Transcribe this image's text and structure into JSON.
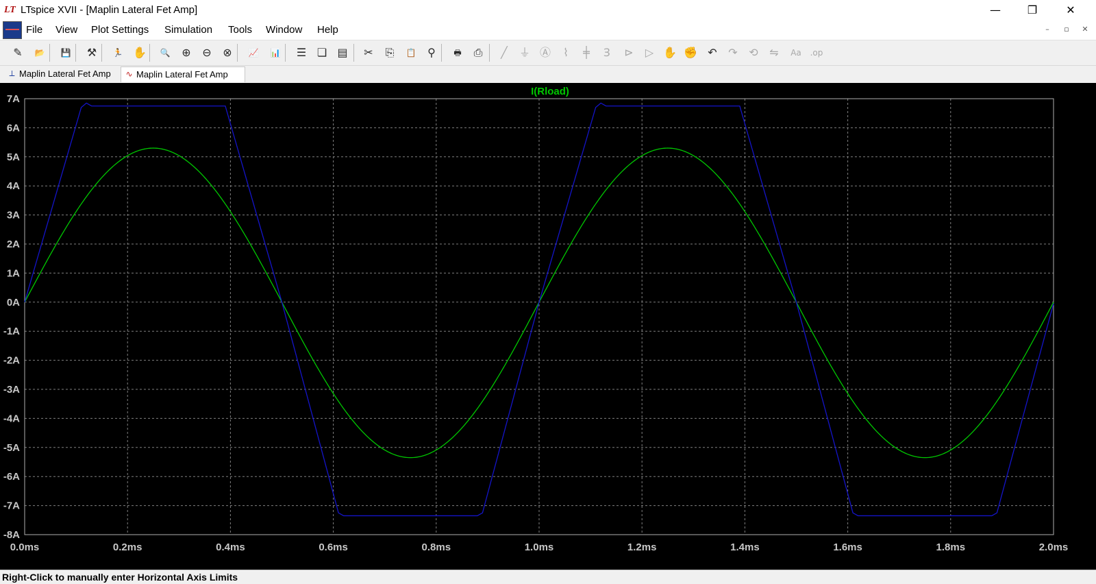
{
  "window": {
    "app_logo": "LT",
    "title": "LTspice XVII - [Maplin Lateral Fet Amp]",
    "controls": {
      "minimize": "—",
      "restore": "❐",
      "close": "✕"
    }
  },
  "menu": {
    "items": [
      "File",
      "View",
      "Plot Settings",
      "Simulation",
      "Tools",
      "Window",
      "Help"
    ],
    "mdi": {
      "minimize": "–",
      "restore": "▫",
      "close": "✕"
    }
  },
  "toolbar": {
    "icons": [
      {
        "name": "new-schematic-icon",
        "glyph": "✎",
        "dim": false
      },
      {
        "name": "open-folder-icon",
        "glyph": "📂",
        "dim": false
      },
      {
        "name": "save-icon",
        "glyph": "💾",
        "dim": false
      },
      {
        "name": "control-panel-icon",
        "glyph": "⚒",
        "dim": false
      },
      {
        "name": "run-icon",
        "glyph": "🏃",
        "dim": false
      },
      {
        "name": "halt-icon",
        "glyph": "✋",
        "dim": true
      },
      {
        "name": "zoom-in-icon",
        "glyph": "🔍",
        "dim": false
      },
      {
        "name": "zoom-area-icon",
        "glyph": "⊕",
        "dim": false
      },
      {
        "name": "zoom-out-icon",
        "glyph": "⊖",
        "dim": false
      },
      {
        "name": "zoom-cancel-icon",
        "glyph": "⊗",
        "dim": false
      },
      {
        "name": "autorange-icon",
        "glyph": "📈",
        "dim": false
      },
      {
        "name": "fft-icon",
        "glyph": "📊",
        "dim": false
      },
      {
        "name": "tile-horizontal-icon",
        "glyph": "☰",
        "dim": false
      },
      {
        "name": "cascade-icon",
        "glyph": "❏",
        "dim": false
      },
      {
        "name": "tile-vertical-icon",
        "glyph": "▤",
        "dim": false
      },
      {
        "name": "cut-icon",
        "glyph": "✂",
        "dim": false
      },
      {
        "name": "copy-icon",
        "glyph": "⎘",
        "dim": false
      },
      {
        "name": "paste-icon",
        "glyph": "📋",
        "dim": false
      },
      {
        "name": "find-icon",
        "glyph": "⚲",
        "dim": false
      },
      {
        "name": "print-icon",
        "glyph": "🖶",
        "dim": false
      },
      {
        "name": "print-setup-icon",
        "glyph": "⎙",
        "dim": false
      },
      {
        "name": "wire-icon",
        "glyph": "╱",
        "dim": true
      },
      {
        "name": "ground-icon",
        "glyph": "⏚",
        "dim": true
      },
      {
        "name": "label-net-icon",
        "glyph": "Ⓐ",
        "dim": true
      },
      {
        "name": "resistor-icon",
        "glyph": "⌇",
        "dim": true
      },
      {
        "name": "capacitor-icon",
        "glyph": "╪",
        "dim": true
      },
      {
        "name": "inductor-icon",
        "glyph": "Ɜ",
        "dim": true
      },
      {
        "name": "diode-icon",
        "glyph": "⊳",
        "dim": true
      },
      {
        "name": "component-icon",
        "glyph": "▷",
        "dim": true
      },
      {
        "name": "move-icon",
        "glyph": "✋",
        "dim": true
      },
      {
        "name": "drag-icon",
        "glyph": "✊",
        "dim": true
      },
      {
        "name": "undo-icon",
        "glyph": "↶",
        "dim": false
      },
      {
        "name": "redo-icon",
        "glyph": "↷",
        "dim": true
      },
      {
        "name": "rotate-icon",
        "glyph": "⟲",
        "dim": true
      },
      {
        "name": "mirror-icon",
        "glyph": "⇋",
        "dim": true
      },
      {
        "name": "text-icon",
        "glyph": "Aa",
        "dim": true
      },
      {
        "name": "spice-directive-icon",
        "glyph": ".op",
        "dim": true
      }
    ]
  },
  "tabs": [
    {
      "label": "Maplin Lateral Fet Amp",
      "icon": "schematic-icon",
      "active": false
    },
    {
      "label": "Maplin Lateral Fet Amp",
      "icon": "waveform-icon",
      "active": true
    }
  ],
  "colors": {
    "plot_background": "#000000",
    "grid": "#808080",
    "axis_text": "#c8c8c8",
    "trace_green": "#00c800",
    "trace_blue": "#1414c8"
  },
  "chart_data": {
    "type": "line",
    "title": "I(Rload)",
    "xlabel": "",
    "ylabel": "",
    "x_ticks": [
      "0.0ms",
      "0.2ms",
      "0.4ms",
      "0.6ms",
      "0.8ms",
      "1.0ms",
      "1.2ms",
      "1.4ms",
      "1.6ms",
      "1.8ms",
      "2.0ms"
    ],
    "y_ticks": [
      "7A",
      "6A",
      "5A",
      "4A",
      "3A",
      "2A",
      "1A",
      "0A",
      "-1A",
      "-2A",
      "-3A",
      "-4A",
      "-5A",
      "-6A",
      "-7A",
      "-8A"
    ],
    "xlim": [
      0,
      2.0
    ],
    "ylim": [
      -8,
      7
    ],
    "x_unit": "ms",
    "y_unit": "A",
    "grid": true,
    "series": [
      {
        "name": "I(Rload)",
        "color": "#00c800",
        "x": [
          0,
          0.125,
          0.25,
          0.375,
          0.5,
          0.625,
          0.75,
          0.875,
          1.0,
          1.125,
          1.25,
          1.375,
          1.5,
          1.625,
          1.75,
          1.875,
          2.0
        ],
        "y": [
          0,
          3.75,
          5.3,
          3.75,
          0,
          -3.75,
          -5.35,
          -3.75,
          0,
          3.75,
          5.3,
          3.75,
          0,
          -3.75,
          -5.35,
          -3.75,
          -0.05
        ]
      },
      {
        "color": "#1414c8",
        "x": [
          0,
          0.11,
          0.12,
          0.13,
          0.39,
          0.5,
          0.61,
          0.62,
          0.88,
          0.89,
          1.0,
          1.11,
          1.12,
          1.13,
          1.39,
          1.5,
          1.61,
          1.62,
          1.88,
          1.89,
          2.0
        ],
        "y": [
          0,
          6.7,
          6.85,
          6.75,
          6.75,
          0,
          -7.25,
          -7.35,
          -7.35,
          -7.25,
          0,
          6.7,
          6.85,
          6.75,
          6.75,
          0,
          -7.25,
          -7.35,
          -7.35,
          -7.25,
          -0.05
        ]
      }
    ]
  },
  "status": {
    "text": "Right-Click to manually enter Horizontal Axis Limits"
  }
}
